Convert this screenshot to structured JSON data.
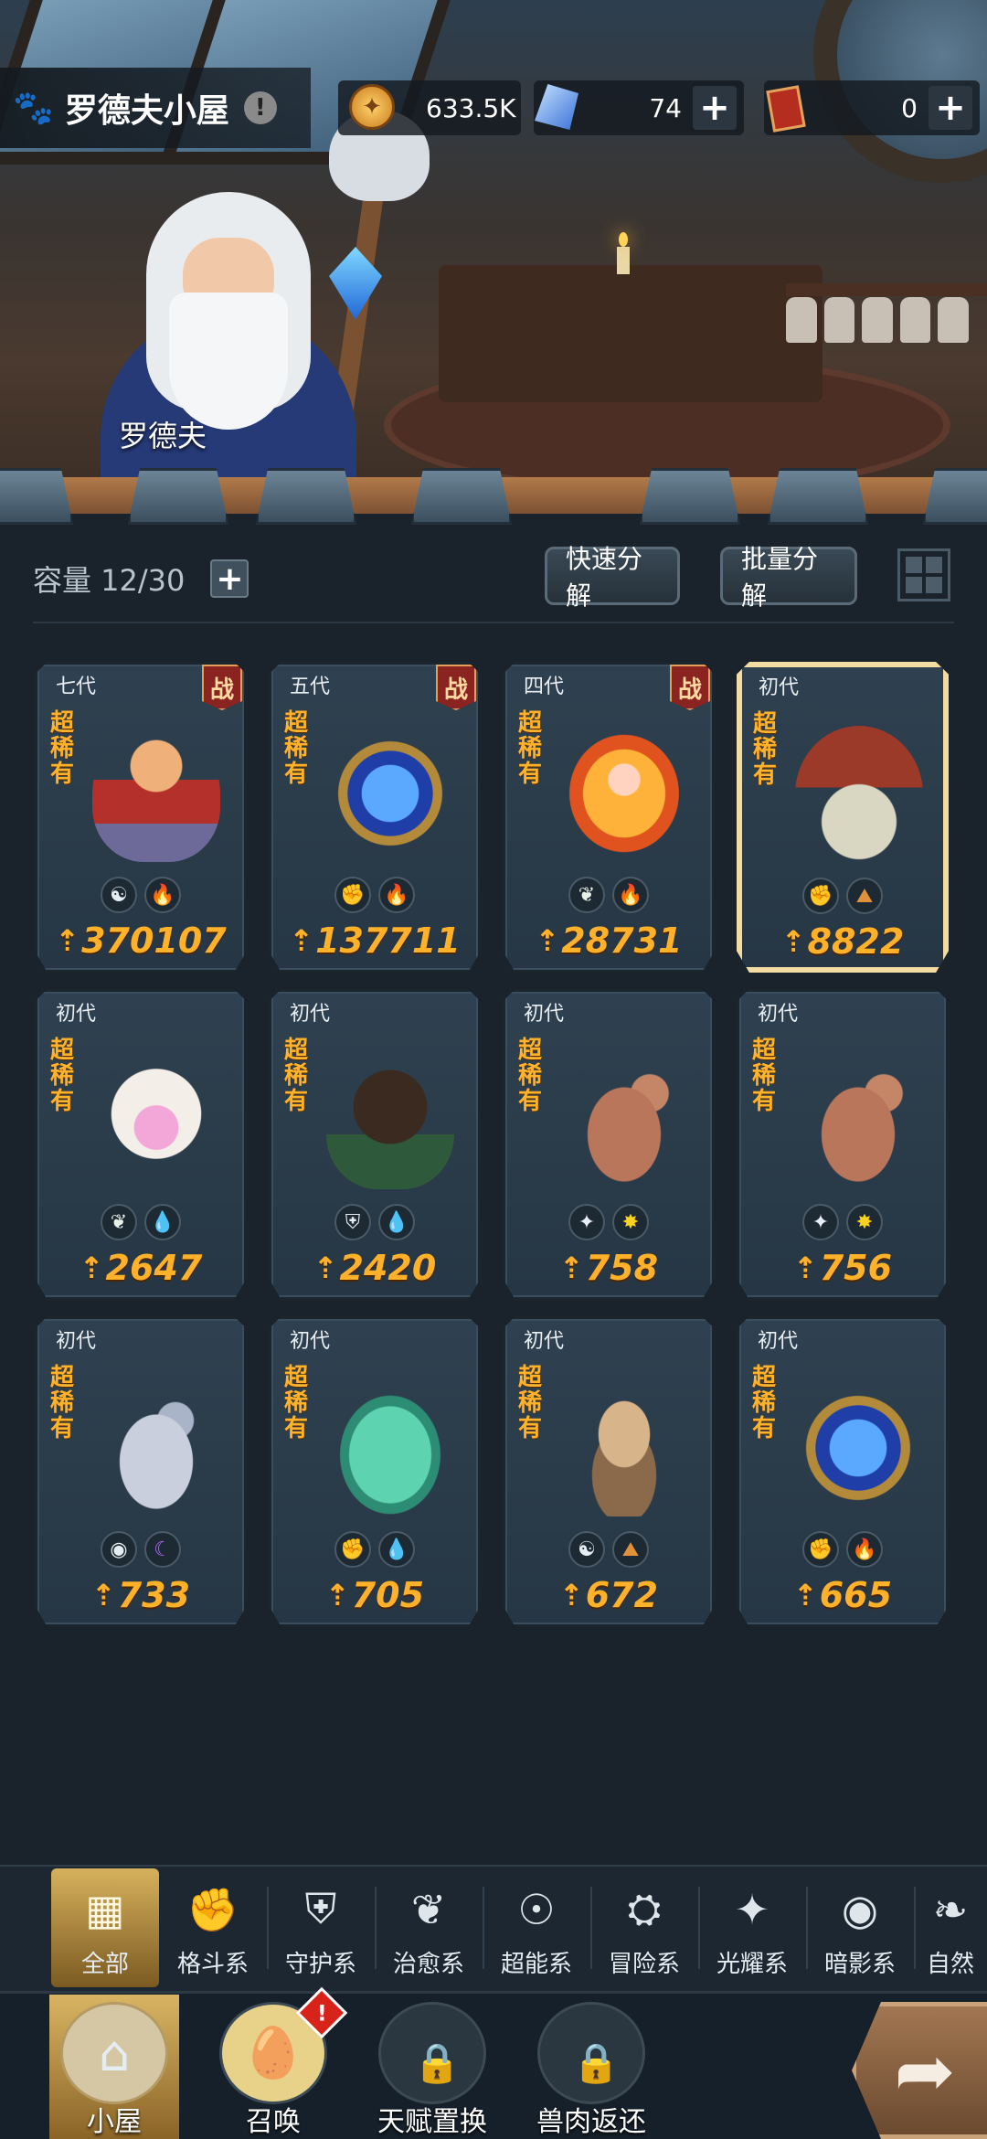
{
  "header": {
    "title": "罗德夫小屋",
    "info_icon": "!",
    "npc_name": "罗德夫"
  },
  "resources": {
    "gold": "633.5K",
    "crystal": "74",
    "ticket": "0"
  },
  "storage": {
    "capacity_label": "容量 12/30",
    "quick_decompose": "快速分解",
    "batch_decompose": "批量分解"
  },
  "cards": [
    {
      "gen": "七代",
      "rarity": "超稀有",
      "battle": "战",
      "power": "370107",
      "elements": [
        "mind-icon",
        "fire-icon"
      ],
      "art": "boy-spear",
      "selected": false
    },
    {
      "gen": "五代",
      "rarity": "超稀有",
      "battle": "战",
      "power": "137711",
      "elements": [
        "fist-icon",
        "fire-icon"
      ],
      "art": "blue-flame-spirit",
      "selected": false
    },
    {
      "gen": "四代",
      "rarity": "超稀有",
      "battle": "战",
      "power": "28731",
      "elements": [
        "leaf-icon",
        "fire-icon"
      ],
      "art": "fire-fairy",
      "selected": false
    },
    {
      "gen": "初代",
      "rarity": "超稀有",
      "battle": "",
      "power": "8822",
      "elements": [
        "fist-icon",
        "earth-icon"
      ],
      "art": "hat-slime",
      "selected": true
    },
    {
      "gen": "初代",
      "rarity": "超稀有",
      "battle": "",
      "power": "2647",
      "elements": [
        "leaf-icon",
        "water-icon"
      ],
      "art": "pink-sheep",
      "selected": false
    },
    {
      "gen": "初代",
      "rarity": "超稀有",
      "battle": "",
      "power": "2420",
      "elements": [
        "shield-icon",
        "water-icon"
      ],
      "art": "tree-sprite",
      "selected": false
    },
    {
      "gen": "初代",
      "rarity": "超稀有",
      "battle": "",
      "power": "758",
      "elements": [
        "light-icon",
        "star-icon"
      ],
      "art": "deer",
      "selected": false
    },
    {
      "gen": "初代",
      "rarity": "超稀有",
      "battle": "",
      "power": "756",
      "elements": [
        "light-icon",
        "star-icon"
      ],
      "art": "deer",
      "selected": false
    },
    {
      "gen": "初代",
      "rarity": "超稀有",
      "battle": "",
      "power": "733",
      "elements": [
        "eye-icon",
        "moon-icon"
      ],
      "art": "grey-kirin",
      "selected": false
    },
    {
      "gen": "初代",
      "rarity": "超稀有",
      "battle": "",
      "power": "705",
      "elements": [
        "fist-icon",
        "water-icon"
      ],
      "art": "water-tree",
      "selected": false
    },
    {
      "gen": "初代",
      "rarity": "超稀有",
      "battle": "",
      "power": "672",
      "elements": [
        "mind-icon",
        "earth-icon"
      ],
      "art": "bronze-dragon",
      "selected": false
    },
    {
      "gen": "初代",
      "rarity": "超稀有",
      "battle": "",
      "power": "665",
      "elements": [
        "fist-icon",
        "fire-icon"
      ],
      "art": "blue-flame-spirit",
      "selected": false
    }
  ],
  "categories": [
    {
      "label": "全部",
      "icon": "blocks-icon",
      "glyph": "▦",
      "active": true
    },
    {
      "label": "格斗系",
      "icon": "fist-icon",
      "glyph": "✊",
      "active": false
    },
    {
      "label": "守护系",
      "icon": "shield-icon",
      "glyph": "⛨",
      "active": false
    },
    {
      "label": "治愈系",
      "icon": "leaf-icon",
      "glyph": "❦",
      "active": false
    },
    {
      "label": "超能系",
      "icon": "alien-icon",
      "glyph": "☉",
      "active": false
    },
    {
      "label": "冒险系",
      "icon": "lantern-icon",
      "glyph": "⛭",
      "active": false
    },
    {
      "label": "光耀系",
      "icon": "sparkle-icon",
      "glyph": "✦",
      "active": false
    },
    {
      "label": "暗影系",
      "icon": "eye-icon",
      "glyph": "◉",
      "active": false
    },
    {
      "label": "自然",
      "icon": "nature-icon",
      "glyph": "❧",
      "active": false
    }
  ],
  "nav": {
    "home": "小屋",
    "summon": "召唤",
    "summon_badge": "!",
    "talent_swap": "天赋置换",
    "meat_return": "兽肉返还"
  },
  "colors": {
    "rarity": "#ffb22a",
    "power": "#ffb12a",
    "selected_border": "#f3dca1",
    "card_bg": "#2f4150"
  }
}
